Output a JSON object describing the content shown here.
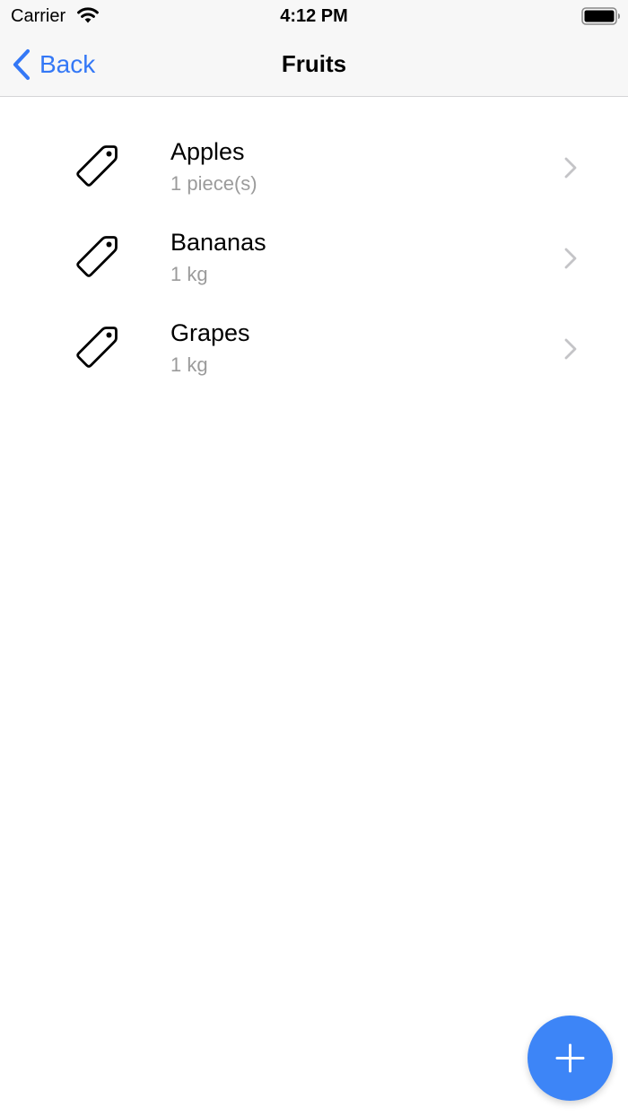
{
  "status_bar": {
    "carrier": "Carrier",
    "time": "4:12 PM",
    "wifi_icon": "wifi-icon",
    "battery_icon": "battery-icon"
  },
  "nav": {
    "back_label": "Back",
    "title": "Fruits",
    "accent_color": "#3478f6"
  },
  "items": [
    {
      "name": "Apples",
      "quantity": "1 piece(s)",
      "icon": "tag-icon"
    },
    {
      "name": "Bananas",
      "quantity": "1 kg",
      "icon": "tag-icon"
    },
    {
      "name": "Grapes",
      "quantity": "1 kg",
      "icon": "tag-icon"
    }
  ],
  "fab": {
    "icon": "plus-icon",
    "color": "#3d85f7"
  }
}
